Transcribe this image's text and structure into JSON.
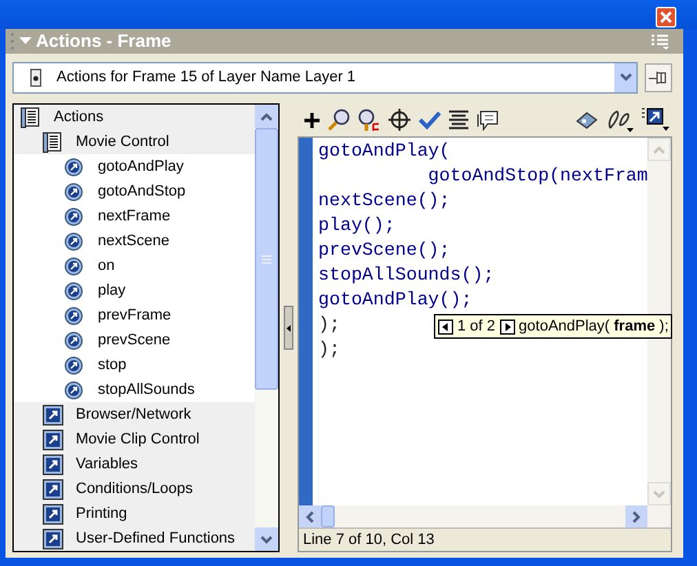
{
  "panel": {
    "title": "Actions - Frame",
    "expanded": true
  },
  "target": {
    "value": "Actions for Frame 15 of Layer Name Layer 1"
  },
  "tree": [
    {
      "label": "Actions",
      "expanded": true,
      "children": [
        {
          "label": "Movie Control",
          "expanded": true,
          "children": [
            {
              "label": "gotoAndPlay"
            },
            {
              "label": "gotoAndStop"
            },
            {
              "label": "nextFrame"
            },
            {
              "label": "nextScene"
            },
            {
              "label": "on"
            },
            {
              "label": "play"
            },
            {
              "label": "prevFrame"
            },
            {
              "label": "prevScene"
            },
            {
              "label": "stop"
            },
            {
              "label": "stopAllSounds"
            }
          ]
        },
        {
          "label": "Browser/Network",
          "expanded": false
        },
        {
          "label": "Movie Clip Control",
          "expanded": false
        },
        {
          "label": "Variables",
          "expanded": false
        },
        {
          "label": "Conditions/Loops",
          "expanded": false
        },
        {
          "label": "Printing",
          "expanded": false
        },
        {
          "label": "User-Defined Functions",
          "expanded": false
        }
      ]
    }
  ],
  "code_lines": [
    {
      "text": "gotoAndPlay(",
      "kind": "keyword"
    },
    {
      "text": "          gotoAndStop(nextFram",
      "kind": "keyword"
    },
    {
      "text": "nextScene();",
      "kind": "keyword"
    },
    {
      "text": "play();",
      "kind": "keyword"
    },
    {
      "text": "prevScene();",
      "kind": "keyword"
    },
    {
      "text": "stopAllSounds();",
      "kind": "keyword"
    },
    {
      "text": "gotoAndPlay();",
      "kind": "keyword"
    },
    {
      "text": ");",
      "kind": "plain"
    },
    {
      "text": ");",
      "kind": "plain"
    }
  ],
  "code_hint": {
    "counter": "1 of 2",
    "signature": "gotoAndPlay( **frame** );"
  },
  "status_bar": "Line 7 of 10, Col 13"
}
